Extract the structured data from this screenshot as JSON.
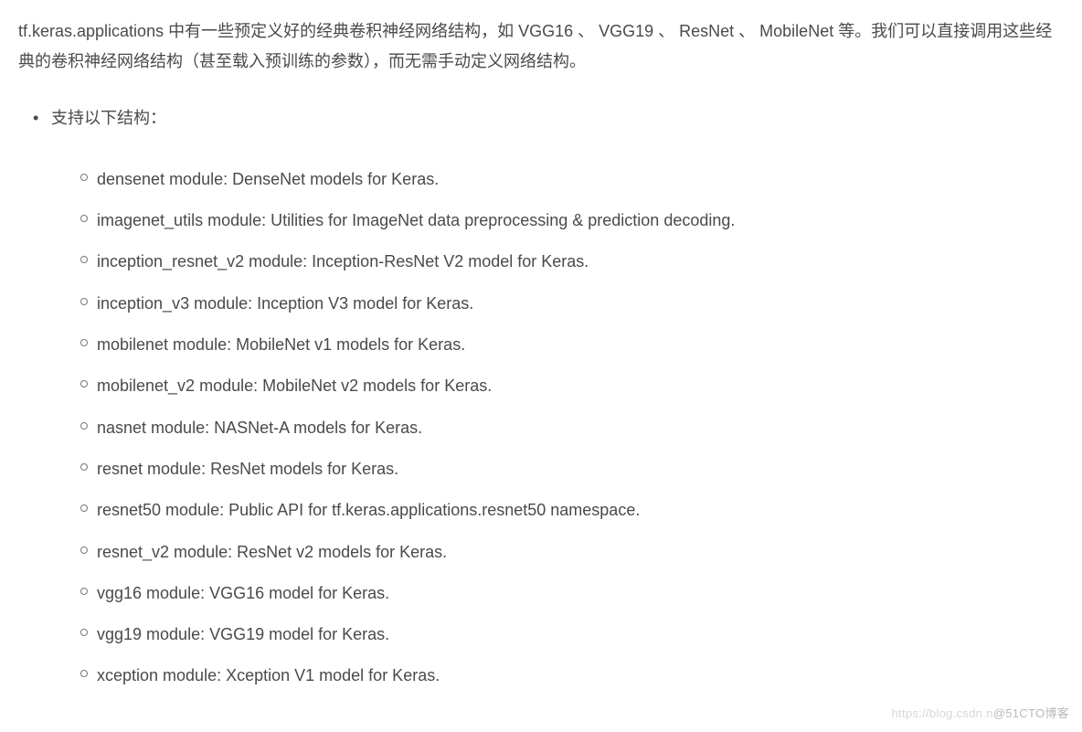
{
  "intro": "tf.keras.applications 中有一些预定义好的经典卷积神经网络结构，如 VGG16 、 VGG19 、 ResNet 、 MobileNet 等。我们可以直接调用这些经典的卷积神经网络结构（甚至载入预训练的参数），而无需手动定义网络结构。",
  "level1_label": "支持以下结构：",
  "modules": [
    "densenet module: DenseNet models for Keras.",
    "imagenet_utils module: Utilities for ImageNet data preprocessing & prediction decoding.",
    "inception_resnet_v2 module: Inception-ResNet V2 model for Keras.",
    "inception_v3 module: Inception V3 model for Keras.",
    "mobilenet module: MobileNet v1 models for Keras.",
    "mobilenet_v2 module: MobileNet v2 models for Keras.",
    "nasnet module: NASNet-A models for Keras.",
    "resnet module: ResNet models for Keras.",
    "resnet50 module: Public API for tf.keras.applications.resnet50 namespace.",
    "resnet_v2 module: ResNet v2 models for Keras.",
    "vgg16 module: VGG16 model for Keras.",
    "vgg19 module: VGG19 model for Keras.",
    "xception module: Xception V1 model for Keras."
  ],
  "watermark_prefix": "https://blog.csdn.n",
  "watermark_suffix": "@51CTO博客"
}
